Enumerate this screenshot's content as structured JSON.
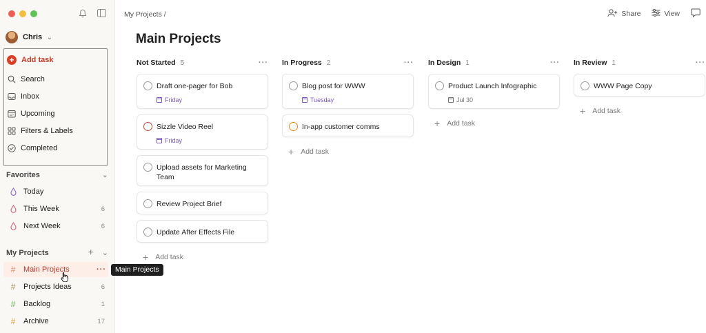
{
  "colors": {
    "brand": "#dc3d22",
    "active_bg": "#fdeee8",
    "purple_date": "#7d5ac7",
    "p1": "#d1453b",
    "p2": "#eb8909"
  },
  "sidebar": {
    "user": "Chris",
    "add_task": "Add task",
    "nav": [
      {
        "label": "Search",
        "icon": "search-icon"
      },
      {
        "label": "Inbox",
        "icon": "inbox-icon"
      },
      {
        "label": "Upcoming",
        "icon": "calendar-icon"
      },
      {
        "label": "Filters & Labels",
        "icon": "grid-icon"
      },
      {
        "label": "Completed",
        "icon": "check-circle-icon"
      }
    ],
    "favorites": {
      "title": "Favorites",
      "items": [
        {
          "label": "Today",
          "count": ""
        },
        {
          "label": "This Week",
          "count": "6"
        },
        {
          "label": "Next Week",
          "count": "6"
        }
      ]
    },
    "projects": {
      "title": "My Projects",
      "items": [
        {
          "label": "Main Projects",
          "count": "",
          "color": "#e88d67"
        },
        {
          "label": "Projects Ideas",
          "count": "6",
          "color": "#a58a5a"
        },
        {
          "label": "Backlog",
          "count": "1",
          "color": "#5fb04e"
        },
        {
          "label": "Archive",
          "count": "17",
          "color": "#e8a33d"
        }
      ]
    },
    "tooltip": "Main Projects"
  },
  "header": {
    "breadcrumb": "My Projects /",
    "share": "Share",
    "view": "View"
  },
  "page_title": "Main Projects",
  "board": {
    "add_task_label": "Add task",
    "columns": [
      {
        "title": "Not Started",
        "count": "5",
        "cards": [
          {
            "title": "Draft one-pager for Bob",
            "due": "Friday"
          },
          {
            "title": "Sizzle Video Reel",
            "due": "Friday"
          },
          {
            "title": "Upload assets for Marketing Team",
            "due": ""
          },
          {
            "title": "Review Project Brief",
            "due": ""
          },
          {
            "title": "Update After Effects File",
            "due": ""
          }
        ]
      },
      {
        "title": "In Progress",
        "count": "2",
        "cards": [
          {
            "title": "Blog post for WWW",
            "due": "Tuesday"
          },
          {
            "title": "In-app customer comms",
            "due": ""
          }
        ]
      },
      {
        "title": "In Design",
        "count": "1",
        "cards": [
          {
            "title": "Product Launch Infographic",
            "due": "Jul 30"
          }
        ]
      },
      {
        "title": "In Review",
        "count": "1",
        "cards": [
          {
            "title": "WWW Page Copy",
            "due": ""
          }
        ]
      }
    ]
  }
}
